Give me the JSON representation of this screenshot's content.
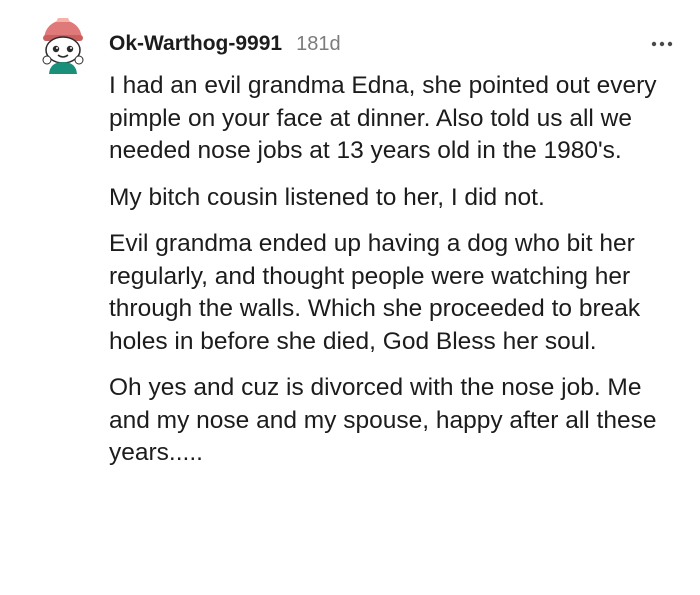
{
  "comment": {
    "author": "Ok-Warthog-9991",
    "age": "181d",
    "avatar_icon": "snoo-avatar-icon",
    "menu_icon": "more-options-icon",
    "paragraphs": [
      "I had an evil grandma Edna, she pointed out every pimple on your face at dinner. Also told us all we needed nose jobs at 13 years old in the 1980's.",
      "My bitch cousin listened to her, I did not.",
      "Evil grandma ended up having a dog who bit her regularly, and thought people were watching her through the walls. Which she proceeded to break holes in before she died, God Bless her soul.",
      "Oh yes and cuz is divorced with the nose job. Me and my nose and my spouse, happy after all these years....."
    ]
  },
  "colors": {
    "text": "#1c1c1c",
    "meta": "#7c7c7c",
    "avatar_hat": "#e07a7a",
    "avatar_body": "#1a8f7a"
  }
}
